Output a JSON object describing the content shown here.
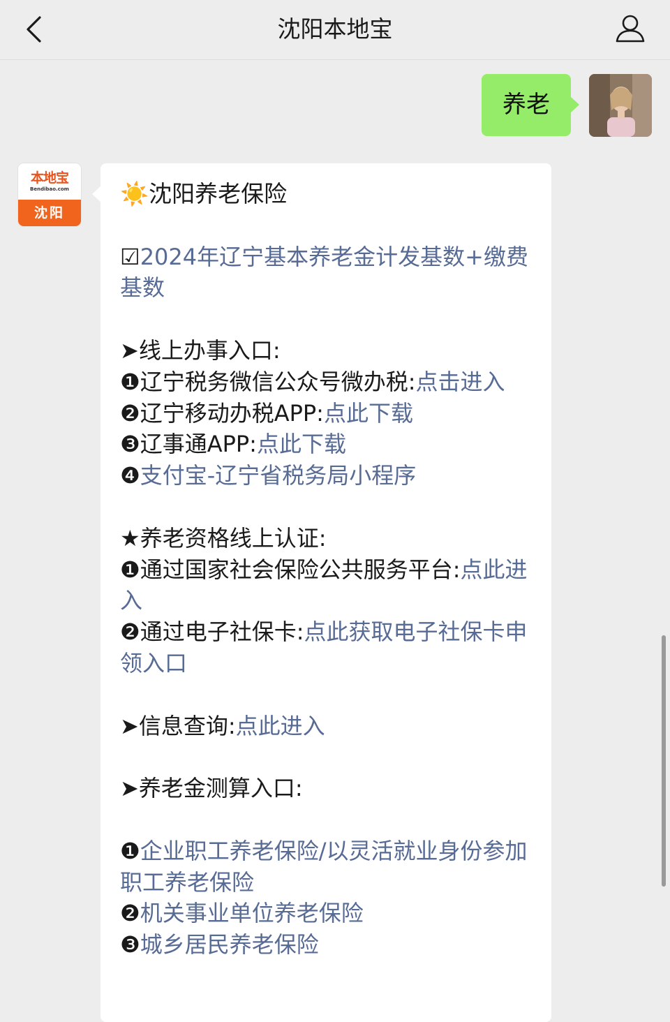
{
  "header": {
    "title": "沈阳本地宝"
  },
  "outgoing": {
    "text": "养老"
  },
  "bot": {
    "brand": "本地宝",
    "domain": "Bendibao.com",
    "city": "沈阳"
  },
  "message": {
    "title_icon": "☀️",
    "title": "沈阳养老保险",
    "item1_prefix": "☑",
    "item1_link": "2024年辽宁基本养老金计发基数+缴费基数",
    "online_head": "➤线上办事入口:",
    "online1_text": "❶辽宁税务微信公众号微办税:",
    "online1_link": "点击进入",
    "online2_text": "❷辽宁移动办税APP:",
    "online2_link": "点此下载",
    "online3_text": "❸辽事通APP:",
    "online3_link": "点此下载",
    "online4_text": "❹",
    "online4_link": "支付宝-辽宁省税务局小程序",
    "cert_head": "★养老资格线上认证:",
    "cert1_text": "❶通过国家社会保险公共服务平台:",
    "cert1_link": "点此进入",
    "cert2_text": "❷通过电子社保卡:",
    "cert2_link": "点此获取电子社保卡申领入口",
    "query_text": "➤信息查询:",
    "query_link": "点此进入",
    "calc_head": "➤养老金测算入口:",
    "calc1_text": "❶",
    "calc1_link": "企业职工养老保险/以灵活就业身份参加职工养老保险",
    "calc2_text": "❷",
    "calc2_link": "机关事业单位养老保险",
    "calc3_text": "❸",
    "calc3_link": "城乡居民养老保险"
  },
  "colors": {
    "link": "#576b95",
    "outgoing_bubble": "#95ec69",
    "background": "#ededed"
  }
}
